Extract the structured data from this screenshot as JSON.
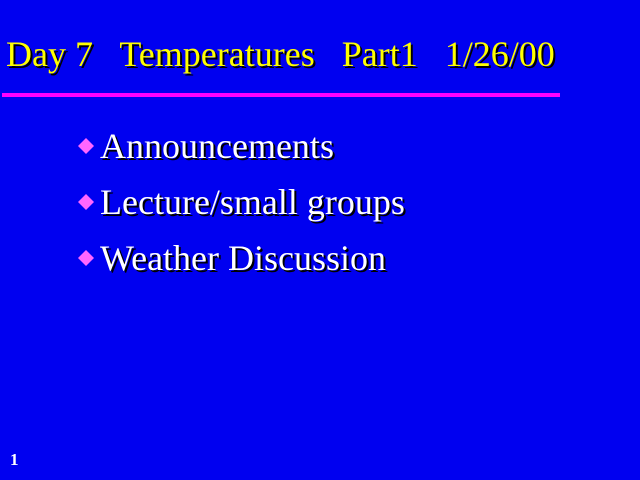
{
  "slide": {
    "title": "Day 7   Temperatures   Part1   1/26/00",
    "bullets": [
      {
        "icon": "diamond-bullet-icon",
        "label": "Announcements"
      },
      {
        "icon": "diamond-bullet-icon",
        "label": "Lecture/small groups"
      },
      {
        "icon": "diamond-bullet-icon",
        "label": "Weather Discussion"
      }
    ],
    "slide_number": "1"
  },
  "colors": {
    "background": "#0000f0",
    "title": "#ffff00",
    "rule": "#ff00ff",
    "bullet": "#ff66ff",
    "text": "#ffffff"
  }
}
